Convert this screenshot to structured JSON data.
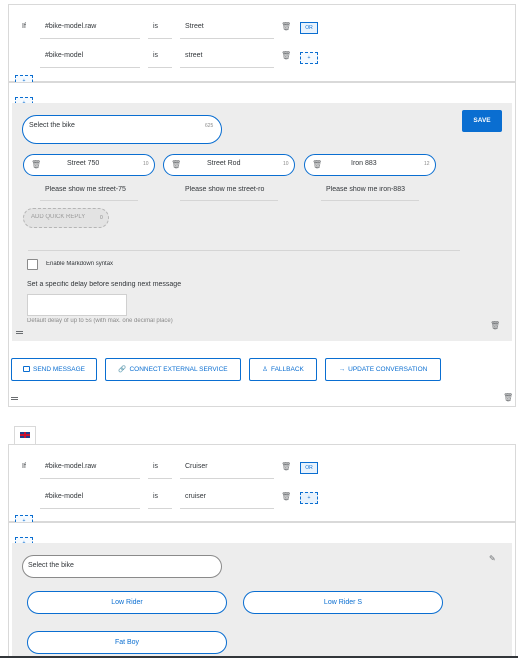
{
  "block1": {
    "if_label": "If",
    "conditions": [
      {
        "field": "#bike-model.raw",
        "operator": "is",
        "value": "Street",
        "button": "OR"
      },
      {
        "field": "#bike-model",
        "operator": "is",
        "value": "street",
        "button": "+"
      }
    ],
    "add_labels": [
      "+",
      "+"
    ],
    "message": {
      "title": "Select the bike",
      "title_count": "625",
      "save_label": "SAVE",
      "quick_replies": [
        {
          "title": "Street 750",
          "count": "10",
          "value": "Please show me street-75"
        },
        {
          "title": "Street Rod",
          "count": "10",
          "value": "Please show me street-ro"
        },
        {
          "title": "Iron 883",
          "count": "12",
          "value": "Please show me iron-883"
        }
      ],
      "add_quick_reply_label": "ADD QUICK REPLY",
      "add_quick_reply_count": "0",
      "markdown_label": "Enable Markdown syntax",
      "delay_label": "Set a specific delay before sending next message",
      "delay_hint": "Default delay of up to 5s (with max. one decimal place)"
    },
    "actions": [
      {
        "label": "SEND MESSAGE",
        "icon": "message-icon"
      },
      {
        "label": "CONNECT EXTERNAL SERVICE",
        "icon": "link-icon"
      },
      {
        "label": "FALLBACK",
        "icon": "person-icon"
      },
      {
        "label": "UPDATE CONVERSATION",
        "icon": "arrow-right-icon"
      }
    ]
  },
  "language_flag": "uk-flag-icon",
  "block2": {
    "if_label": "If",
    "conditions": [
      {
        "field": "#bike-model.raw",
        "operator": "is",
        "value": "Cruiser",
        "button": "OR"
      },
      {
        "field": "#bike-model",
        "operator": "is",
        "value": "cruiser",
        "button": "+"
      }
    ],
    "add_labels": [
      "+",
      "+"
    ],
    "message": {
      "title": "Select the bike",
      "quick_replies": [
        "Low Rider",
        "Low Rider S",
        "Fat Boy"
      ]
    }
  }
}
